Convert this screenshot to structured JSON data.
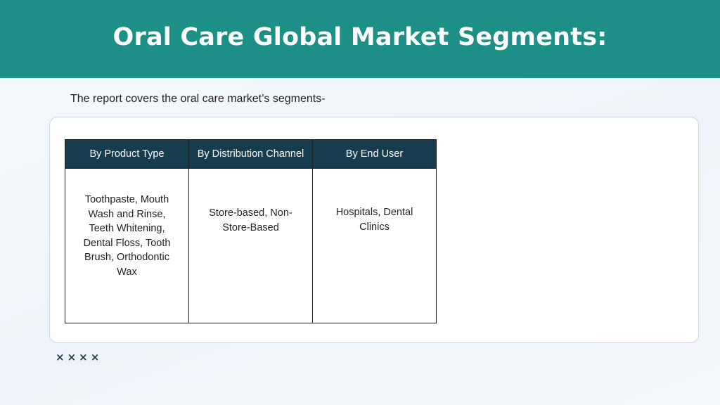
{
  "slide": {
    "title": "Oral Care Global Market Segments:",
    "intro": "The report covers the oral care market’s segments-",
    "accent_color": "#1c9087",
    "table_header_color": "#163d4f"
  },
  "table": {
    "headers": [
      "By Product Type",
      "By Distribution Channel",
      "By End User"
    ],
    "cells": [
      "Toothpaste, Mouth Wash and Rinse, Teeth Whitening, Dental Floss, Tooth Brush, Orthodontic Wax",
      "Store-based, Non-Store-Based",
      "Hospitals, Dental Clinics"
    ]
  },
  "decoration": {
    "marks": [
      "×",
      "×",
      "×",
      "×"
    ],
    "icon": "cross-marks-icon"
  }
}
